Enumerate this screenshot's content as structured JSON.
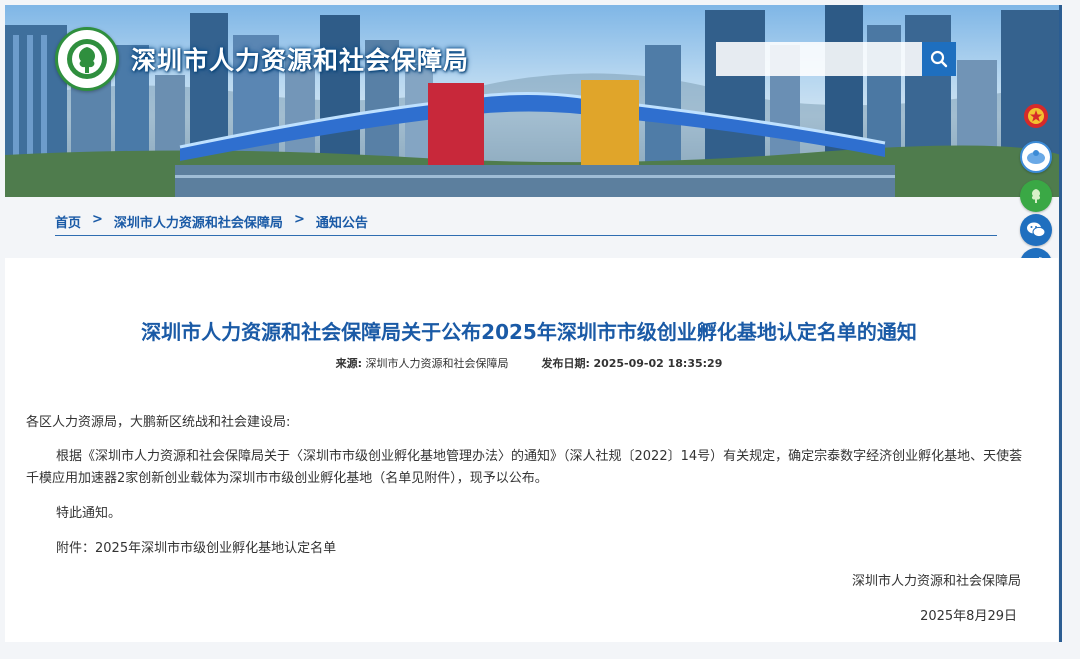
{
  "site": {
    "title": "深圳市人力资源和社会保障局"
  },
  "search": {
    "placeholder": "",
    "icon": "search-icon"
  },
  "breadcrumb": {
    "items": [
      "首页",
      "深圳市人力资源和社会保障局",
      "通知公告"
    ],
    "separator": ">"
  },
  "article": {
    "title": "深圳市人力资源和社会保障局关于公布2025年深圳市市级创业孵化基地认定名单的通知",
    "source_label": "来源:",
    "source_value": "深圳市人力资源和社会保障局",
    "date_label": "发布日期:",
    "date_value": "2025-09-02 18:35:29",
    "salutation": "各区人力资源局，大鹏新区统战和社会建设局:",
    "paragraph_main": "根据《深圳市人力资源和社会保障局关于〈深圳市市级创业孵化基地管理办法〉的通知》（深人社规〔2022〕14号）有关规定，确定宗泰数字经济创业孵化基地、天使荟千模应用加速器2家创新创业载体为深圳市市级创业孵化基地（名单见附件），现予以公布。",
    "paragraph_notice": "特此通知。",
    "attachment": "附件：2025年深圳市市级创业孵化基地认定名单",
    "signature": "深圳市人力资源和社会保障局",
    "sign_date": "2025年8月29日"
  },
  "side_tools": [
    {
      "icon": "national-emblem-icon"
    },
    {
      "icon": "elder-mode-icon"
    },
    {
      "icon": "tree-emblem-icon"
    },
    {
      "icon": "wechat-icon"
    },
    {
      "icon": "weibo-icon"
    },
    {
      "icon": "mobile-app-icon"
    },
    {
      "icon": "customer-service-icon"
    }
  ],
  "colors": {
    "accent": "#1a5aa6",
    "button": "#1e6fbf",
    "text": "#333333"
  }
}
